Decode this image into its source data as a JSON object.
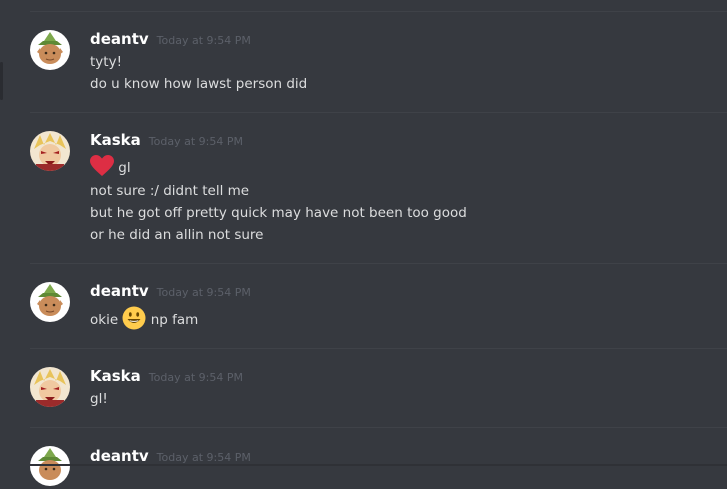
{
  "messages": [
    {
      "username": "deantv",
      "timestamp": "Today at 9:54 PM",
      "lines": [
        "tyty!",
        "do u know how lawst person did"
      ]
    },
    {
      "username": "Kaska",
      "timestamp": "Today at 9:54 PM",
      "lines": [
        "gl",
        "not sure :/ didnt tell me",
        "but he got off pretty quick may have not been too good",
        "or he did an allin not sure"
      ]
    },
    {
      "username": "deantv",
      "timestamp": "Today at 9:54 PM",
      "lines": [
        "okie",
        "np fam"
      ]
    },
    {
      "username": "Kaska",
      "timestamp": "Today at 9:54 PM",
      "lines": [
        "gl!"
      ]
    },
    {
      "username": "deantv",
      "timestamp": "Today at 9:54 PM",
      "lines": []
    }
  ],
  "icons": {
    "heart": "heart-emoji-icon",
    "smiley": "smiley-emoji-icon"
  },
  "colors": {
    "background": "#36393f",
    "username": "#ffffff",
    "text": "#dcddde",
    "timestamp": "#5c6069",
    "heart": "#dd2e44",
    "smiley": "#ffcc4d"
  }
}
